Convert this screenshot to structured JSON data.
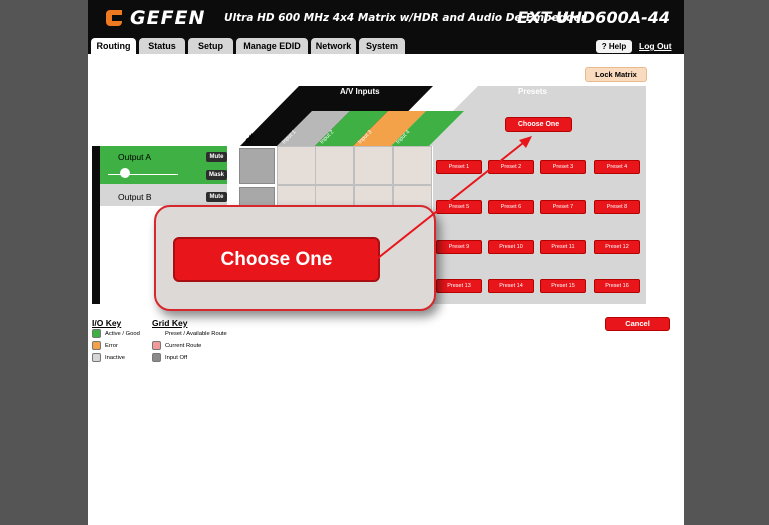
{
  "header": {
    "logo_text": "GEFEN",
    "product_title": "Ultra HD 600 MHz 4x4 Matrix w/HDR and Audio De-Embedder",
    "model": "EXT-UHD600A-44",
    "help_label": "? Help",
    "logout_label": "Log Out"
  },
  "tabs": [
    "Routing",
    "Status",
    "Setup",
    "Manage EDID",
    "Network",
    "System"
  ],
  "active_tab": "Routing",
  "routing": {
    "lock_label": "Lock Matrix",
    "inputs_header": "A/V Inputs",
    "presets_header": "Presets",
    "off_label": "Off",
    "inputs": [
      "Input 1",
      "Input 2",
      "Input 3",
      "Input 4"
    ],
    "outputs": [
      {
        "label": "Output A",
        "mute_label": "Mute",
        "mask_label": "Mask"
      },
      {
        "label": "Output B",
        "mute_label": "Mute"
      }
    ],
    "choose_label": "Choose One",
    "presets": [
      "Preset 1",
      "Preset 2",
      "Preset 3",
      "Preset 4",
      "Preset 5",
      "Preset 6",
      "Preset 7",
      "Preset 8",
      "Preset 9",
      "Preset 10",
      "Preset 11",
      "Preset 12",
      "Preset 13",
      "Preset 14",
      "Preset 15",
      "Preset 16"
    ],
    "cancel_label": "Cancel"
  },
  "callout": {
    "label": "Choose One"
  },
  "io_key": {
    "title": "I/O Key",
    "items": [
      "Active / Good",
      "Error",
      "Inactive"
    ]
  },
  "grid_key": {
    "title": "Grid Key",
    "items": [
      "Preset / Available Route",
      "Current Route",
      "Input Off"
    ]
  },
  "colors": {
    "active_green": "#3fb044",
    "error_orange": "#f4a24a",
    "inactive_gray": "#d6d6d6",
    "preset_red": "#e8151b",
    "current_route_pink": "#f19a9a",
    "input_off_gray": "#8a8a8a",
    "brand_orange": "#f07a1f"
  },
  "icons": [
    "logo-mark-icon",
    "slider-knob-icon",
    "callout-arrow-icon"
  ]
}
